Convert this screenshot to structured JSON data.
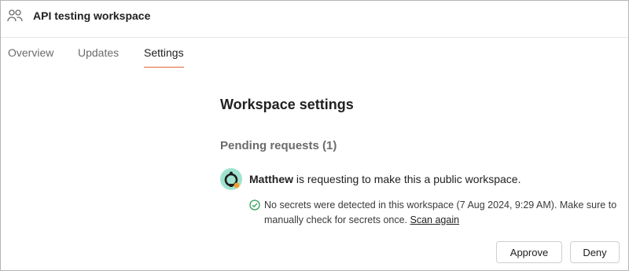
{
  "header": {
    "workspace_icon": "people-icon",
    "title": "API testing workspace"
  },
  "tabs": [
    {
      "label": "Overview",
      "active": false
    },
    {
      "label": "Updates",
      "active": false
    },
    {
      "label": "Settings",
      "active": true
    }
  ],
  "main": {
    "title": "Workspace settings",
    "pending_title": "Pending requests (1)",
    "request": {
      "avatar_icon": "user-avatar-icon",
      "user": "Matthew",
      "text": " is requesting to make this a public workspace.",
      "check_icon": "check-circle-icon",
      "note": "No secrets were detected in this workspace (7 Aug 2024, 9:29 AM). Make sure to manually check for secrets once. ",
      "link": "Scan again"
    },
    "actions": {
      "approve": "Approve",
      "deny": "Deny"
    }
  },
  "colors": {
    "tab_active_underline": "#e0633a",
    "success": "#2e9e53",
    "avatar_bg": "#9fe3cf"
  }
}
